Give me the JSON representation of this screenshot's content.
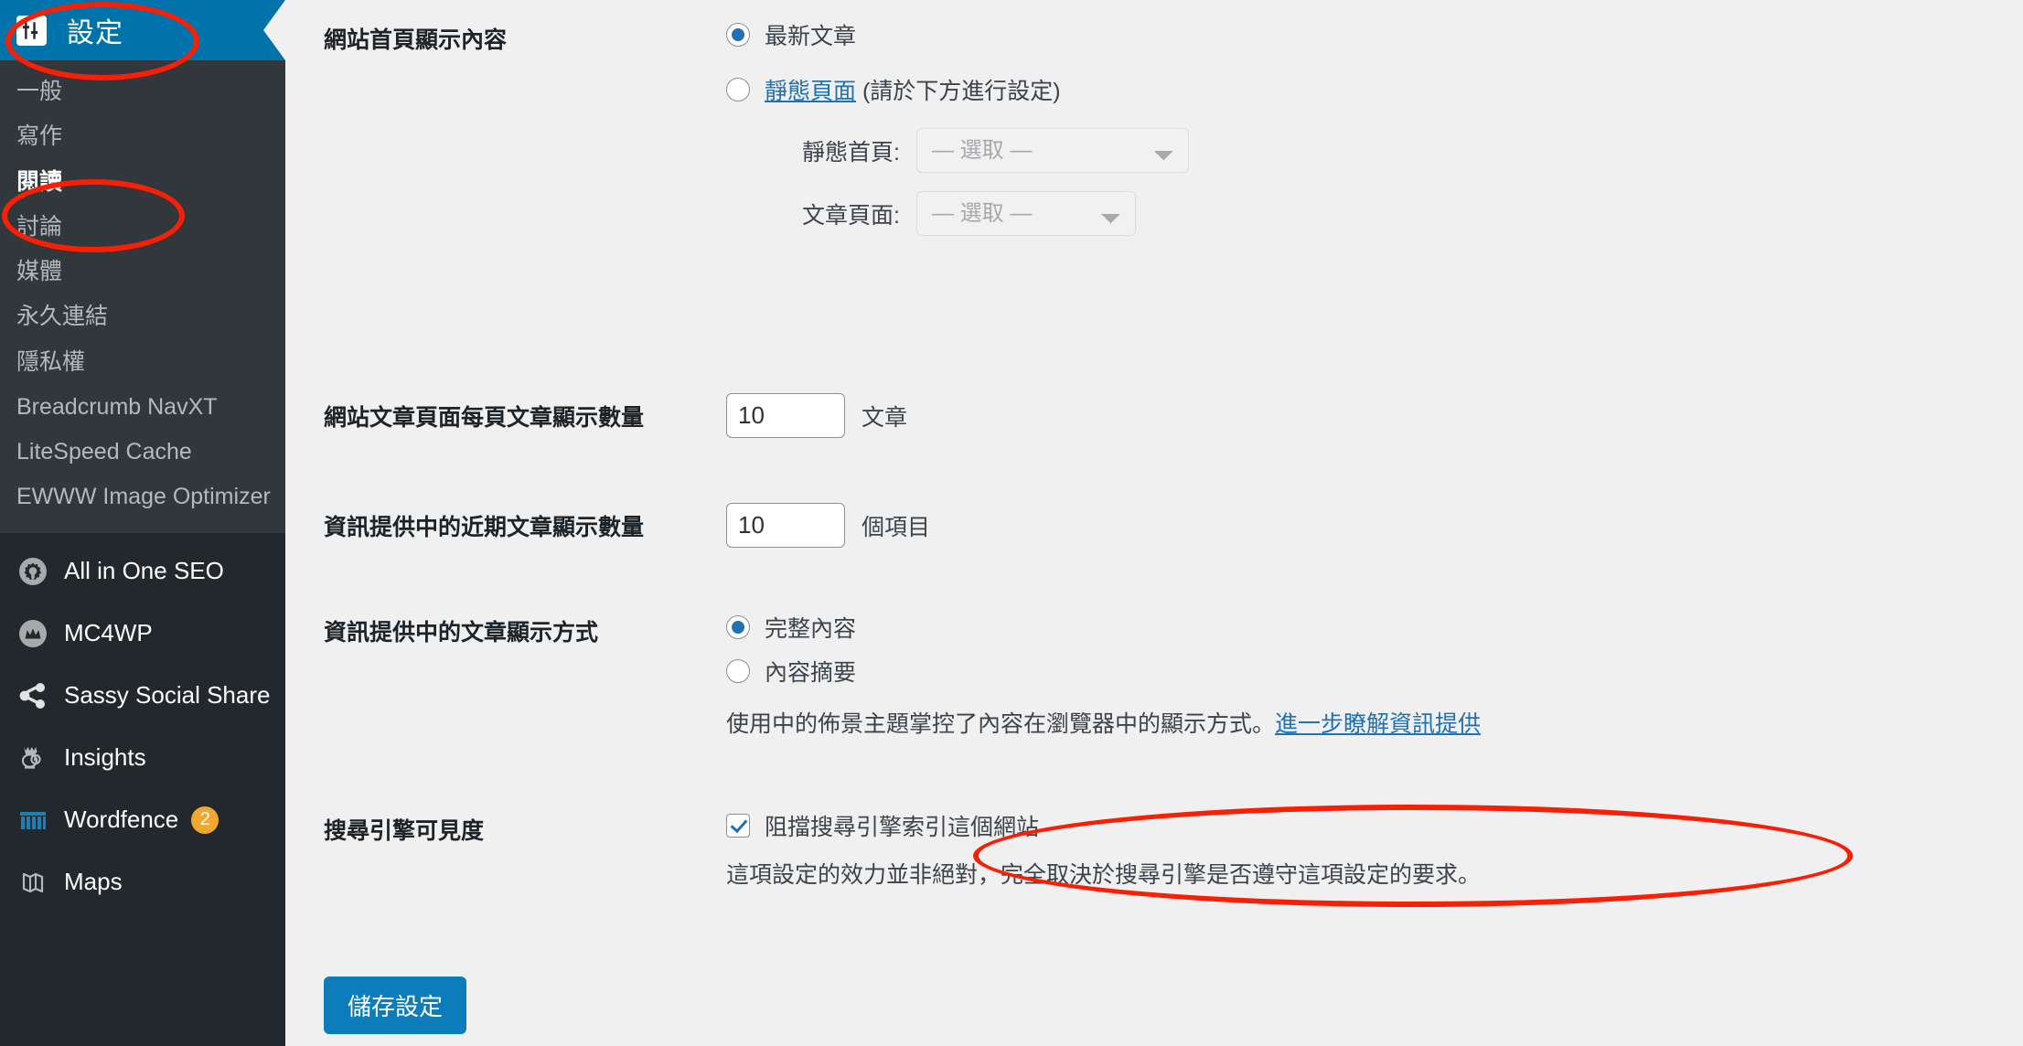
{
  "sidebar": {
    "header": {
      "label": "設定",
      "icon": "sliders-icon"
    },
    "submenu": [
      {
        "label": "一般",
        "current": false
      },
      {
        "label": "寫作",
        "current": false
      },
      {
        "label": "閱讀",
        "current": true
      },
      {
        "label": "討論",
        "current": false
      },
      {
        "label": "媒體",
        "current": false
      },
      {
        "label": "永久連結",
        "current": false
      },
      {
        "label": "隱私權",
        "current": false
      },
      {
        "label": "Breadcrumb NavXT",
        "current": false
      },
      {
        "label": "LiteSpeed Cache",
        "current": false
      },
      {
        "label": "EWWW Image Optimizer",
        "current": false
      }
    ],
    "plugins": [
      {
        "label": "All in One SEO",
        "icon": "aioseo-gear-icon",
        "badge": ""
      },
      {
        "label": "MC4WP",
        "icon": "mailchimp-icon",
        "badge": ""
      },
      {
        "label": "Sassy Social Share",
        "icon": "share-nodes-icon",
        "badge": ""
      },
      {
        "label": "Insights",
        "icon": "monsterinsights-icon",
        "badge": ""
      },
      {
        "label": "Wordfence",
        "icon": "wordfence-icon",
        "badge": "2"
      },
      {
        "label": "Maps",
        "icon": "maps-icon",
        "badge": ""
      }
    ]
  },
  "main": {
    "front_page": {
      "label": "網站首頁顯示內容",
      "option_posts": "最新文章",
      "option_page_link": "靜態頁面",
      "option_page_suffix": " (請於下方進行設定)",
      "posts_selected": true,
      "static_front_label": "靜態首頁:",
      "static_front_value": "— 選取 —",
      "posts_page_label": "文章頁面:",
      "posts_page_value": "— 選取 —"
    },
    "posts_per_page": {
      "label": "網站文章頁面每頁文章顯示數量",
      "value": "10",
      "suffix": "文章"
    },
    "posts_per_rss": {
      "label": "資訊提供中的近期文章顯示數量",
      "value": "10",
      "suffix": "個項目"
    },
    "rss_use_excerpt": {
      "label": "資訊提供中的文章顯示方式",
      "option_full": "完整內容",
      "option_excerpt": "內容摘要",
      "full_selected": true,
      "description": "使用中的佈景主題掌控了內容在瀏覽器中的顯示方式。",
      "description_link": "進一步瞭解資訊提供"
    },
    "search_visibility": {
      "label": "搜尋引擎可見度",
      "checkbox_label": "阻擋搜尋引擎索引這個網站",
      "checked": true,
      "description": "這項設定的效力並非絕對，完全取決於搜尋引擎是否遵守這項設定的要求。"
    },
    "submit": {
      "label": "儲存設定"
    }
  }
}
